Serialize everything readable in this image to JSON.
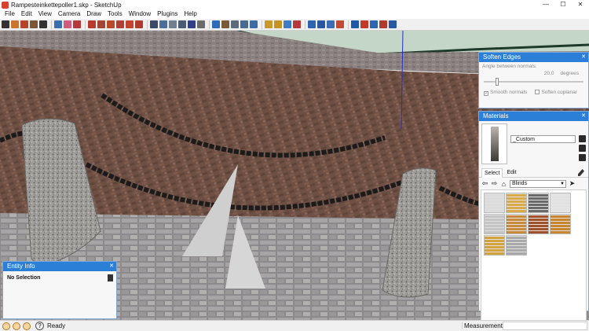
{
  "window": {
    "title": "Rampesteinkettepoller1.skp - SketchUp",
    "controls": [
      "—",
      "☐",
      "✕"
    ]
  },
  "menu": [
    "File",
    "Edit",
    "View",
    "Camera",
    "Draw",
    "Tools",
    "Window",
    "Plugins",
    "Help"
  ],
  "toolbar_icons": [
    {
      "name": "select-icon",
      "color": "#333333"
    },
    {
      "name": "pencil-icon",
      "color": "#c9762a"
    },
    {
      "name": "rectangle-icon",
      "color": "#b4442a"
    },
    {
      "name": "circle-icon",
      "color": "#7a5536"
    },
    {
      "name": "arc-icon",
      "color": "#333333"
    },
    {
      "name": "sep"
    },
    {
      "name": "make-component-icon",
      "color": "#3a6fb0"
    },
    {
      "name": "eraser-icon",
      "color": "#d05b7c"
    },
    {
      "name": "paint-bucket-icon",
      "color": "#b5393b"
    },
    {
      "name": "sep"
    },
    {
      "name": "move-icon",
      "color": "#b63a2e"
    },
    {
      "name": "push-pull-icon",
      "color": "#a34536"
    },
    {
      "name": "rotate-icon",
      "color": "#b84a2a"
    },
    {
      "name": "follow-me-icon",
      "color": "#b04035"
    },
    {
      "name": "scale-icon",
      "color": "#c4432f"
    },
    {
      "name": "offset-icon",
      "color": "#b13a2f"
    },
    {
      "name": "sep"
    },
    {
      "name": "tape-measure-icon",
      "color": "#3b4a66"
    },
    {
      "name": "dimension-icon",
      "color": "#4d6e99"
    },
    {
      "name": "protractor-icon",
      "color": "#6f8090"
    },
    {
      "name": "text-icon",
      "color": "#4a5b75"
    },
    {
      "name": "axes-icon",
      "color": "#2f3e87"
    },
    {
      "name": "3d-text-icon",
      "color": "#6b6b6b"
    },
    {
      "name": "sep"
    },
    {
      "name": "orbit-icon",
      "color": "#2f6cb8"
    },
    {
      "name": "pan-icon",
      "color": "#7a5a36"
    },
    {
      "name": "zoom-icon",
      "color": "#5b6b7b"
    },
    {
      "name": "zoom-window-icon",
      "color": "#4a6a8e"
    },
    {
      "name": "zoom-extents-icon",
      "color": "#3d6ca5"
    },
    {
      "name": "sep"
    },
    {
      "name": "warehouse-icon",
      "color": "#c79a2a"
    },
    {
      "name": "share-model-icon",
      "color": "#c49324"
    },
    {
      "name": "components-icon",
      "color": "#3b7cc4"
    },
    {
      "name": "extension-warehouse-icon",
      "color": "#b5393b"
    },
    {
      "name": "sep"
    },
    {
      "name": "position-camera-icon",
      "color": "#2d64b0"
    },
    {
      "name": "walk-icon",
      "color": "#2a58a0"
    },
    {
      "name": "look-around-icon",
      "color": "#3b6db5"
    },
    {
      "name": "section-plane-icon",
      "color": "#c04b36"
    },
    {
      "name": "sep"
    },
    {
      "name": "solid-tools-icon",
      "color": "#1e5aa6"
    },
    {
      "name": "outer-shell-icon",
      "color": "#c0392b"
    },
    {
      "name": "intersect-icon",
      "color": "#2d64b0"
    },
    {
      "name": "union-icon",
      "color": "#b03a2e"
    },
    {
      "name": "subtract-icon",
      "color": "#2a58a0"
    }
  ],
  "soften_edges": {
    "title": "Soften Edges",
    "angle_label": "Angle between normals:",
    "angle_value": "20,0",
    "angle_unit": "degrees",
    "slider_fraction": 0.12,
    "smooth_normals_label": "Smooth normals",
    "smooth_normals_checked": true,
    "soften_coplanar_label": "Soften coplanar",
    "soften_coplanar_checked": false
  },
  "materials": {
    "title": "Materials",
    "material_name": "_Custom",
    "tabs": [
      {
        "label": "Select",
        "active": true
      },
      {
        "label": "Edit",
        "active": false
      }
    ],
    "collection": "Blinds",
    "swatches": [
      {
        "name": "blinds-white-1",
        "color": "#dcdcdc"
      },
      {
        "name": "blinds-wood-light",
        "color": "#d9a94a"
      },
      {
        "name": "blinds-dark-grey",
        "color": "#6a6a6a"
      },
      {
        "name": "blinds-white-2",
        "color": "#e4e4e4"
      },
      {
        "name": "blinds-silver",
        "color": "#c4c4c4"
      },
      {
        "name": "blinds-wood-mid",
        "color": "#c8893a"
      },
      {
        "name": "blinds-wood-red",
        "color": "#a0532a"
      },
      {
        "name": "blinds-wood-orange",
        "color": "#c9852d"
      },
      {
        "name": "blinds-wood-yellow",
        "color": "#d5a23c"
      },
      {
        "name": "blinds-metal",
        "color": "#a9a9a9"
      }
    ]
  },
  "entity_info": {
    "title": "Entity Info",
    "selection": "No Selection"
  },
  "status": {
    "text": "Ready",
    "help": "?",
    "measurements_label": "Measurements",
    "measurements_value": ""
  },
  "colors": {
    "panel_header": "#2b7fd6",
    "sky": "#c4d6c8",
    "brick": "#6e4f43",
    "stone": "#9f9d9a"
  }
}
